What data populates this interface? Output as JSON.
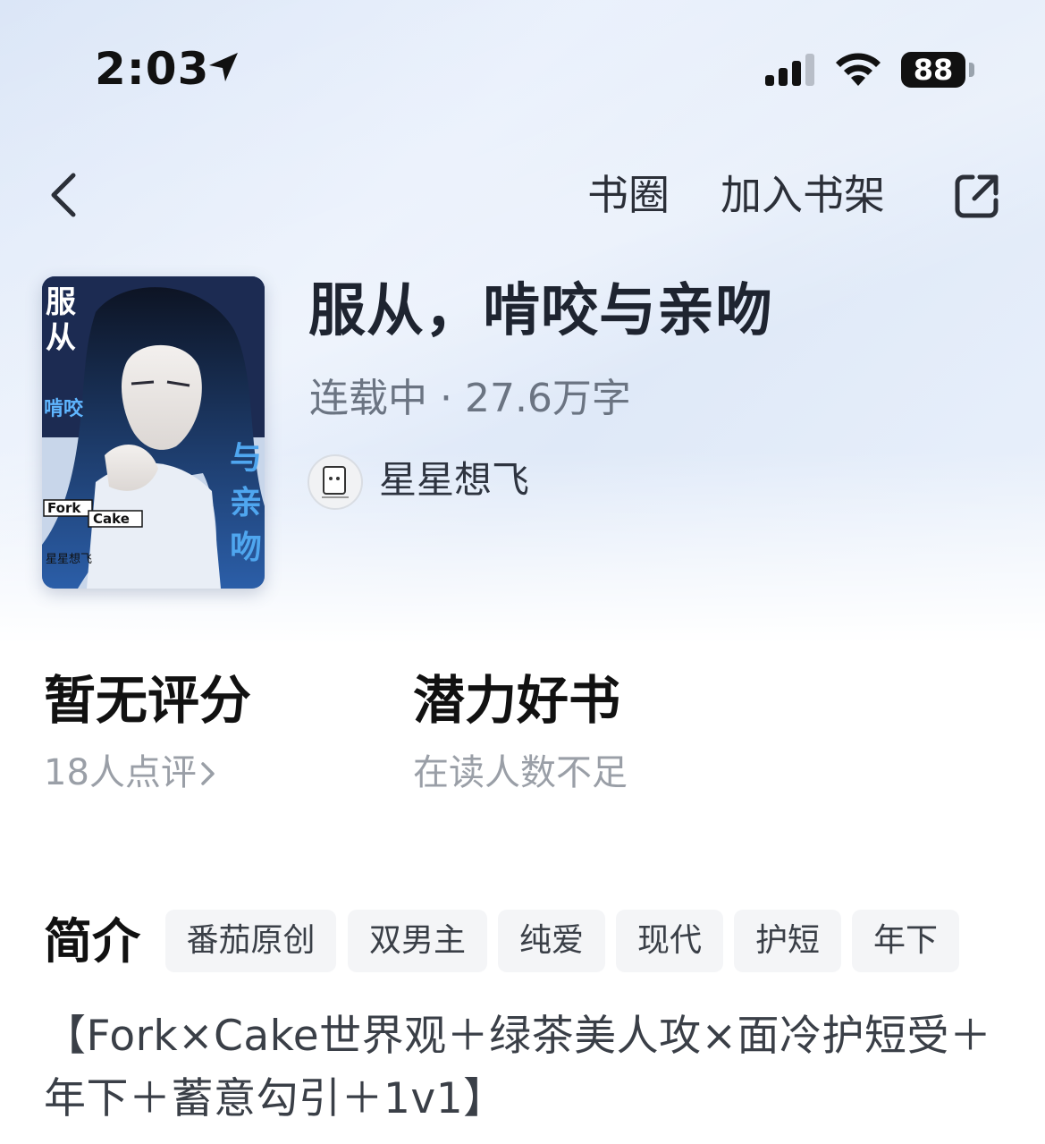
{
  "status_bar": {
    "time": "2:03",
    "battery": "88"
  },
  "nav": {
    "circle_label": "书圈",
    "add_shelf_label": "加入书架",
    "icons": [
      "chevron-left-icon",
      "share-icon"
    ]
  },
  "book": {
    "title": "服从，啃咬与亲吻",
    "meta": "连载中 · 27.6万字",
    "author": "星星想飞",
    "cover_text": {
      "title_chars": [
        "服",
        "从",
        "啃咬",
        "与",
        "亲",
        "吻"
      ],
      "fork": "Fork",
      "cake": "Cake",
      "author": "星星想飞"
    }
  },
  "stats": {
    "rating_title": "暂无评分",
    "rating_sub": "18人点评",
    "potential_title": "潜力好书",
    "potential_sub": "在读人数不足"
  },
  "intro": {
    "heading": "简介",
    "tags": [
      "番茄原创",
      "双男主",
      "纯爱",
      "现代",
      "护短",
      "年下"
    ],
    "text": "【Fork×Cake世界观＋绿茶美人攻×面冷护短受＋年下＋蓄意勾引＋1v1】"
  },
  "colors": {
    "background_top": "#dfe9f8",
    "title_text": "#1e2430",
    "muted_text": "#9a9fa7",
    "tag_background": "#f4f5f7"
  }
}
